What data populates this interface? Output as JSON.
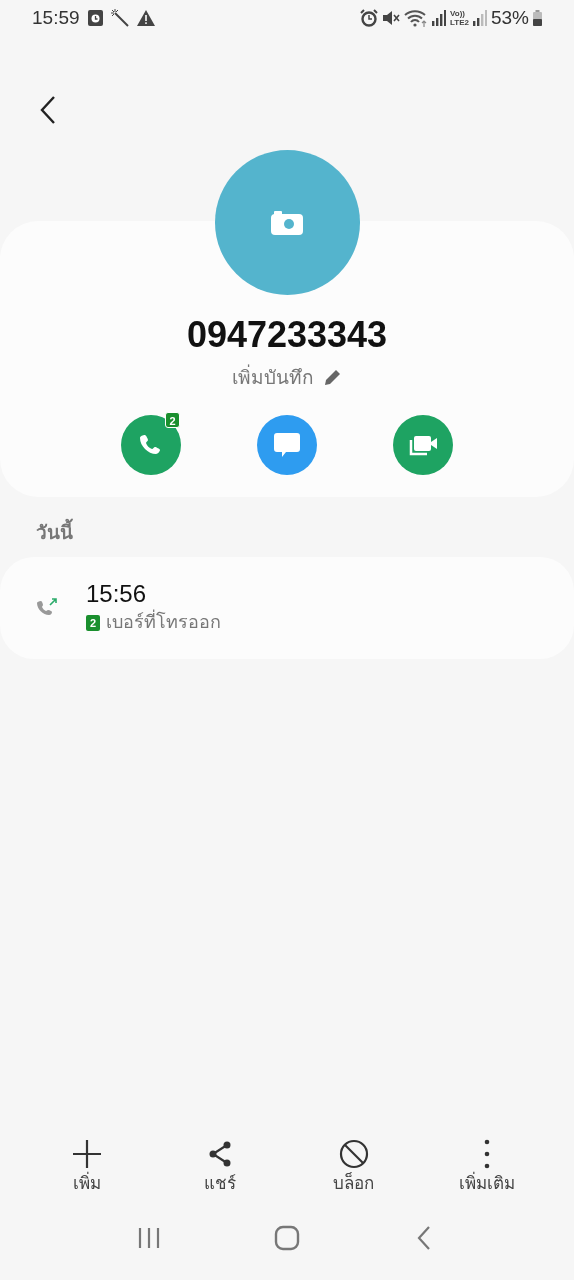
{
  "status_bar": {
    "time": "15:59",
    "network_label_top": "Vo))",
    "network_label_bottom": "LTE2",
    "battery": "53%"
  },
  "contact": {
    "number": "0947233343",
    "note": "เพิ่มบันทึก"
  },
  "actions": [
    {
      "kind": "call",
      "badge": "2",
      "color": "#1ea362"
    },
    {
      "kind": "message",
      "color": "#2e9cf0"
    },
    {
      "kind": "video",
      "color": "#1ea362"
    }
  ],
  "history": {
    "heading": "วันนี้",
    "entries": [
      {
        "time": "15:56",
        "sim": "2",
        "type": "เบอร์ที่โทรออก"
      }
    ]
  },
  "toolbar": [
    {
      "kind": "add",
      "label": "เพิ่ม"
    },
    {
      "kind": "share",
      "label": "แชร์"
    },
    {
      "kind": "block",
      "label": "บล็อก"
    },
    {
      "kind": "more",
      "label": "เพิ่มเติม"
    }
  ]
}
